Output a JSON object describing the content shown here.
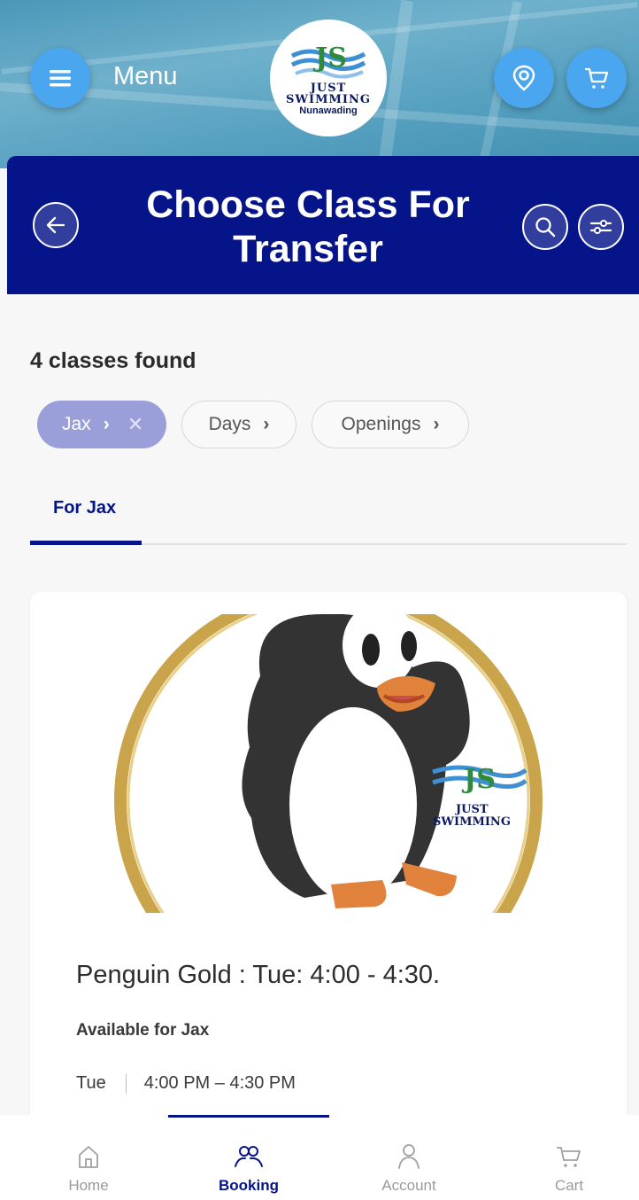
{
  "header": {
    "menu_label": "Menu",
    "logo": {
      "line1": "JUST",
      "line2": "SWIMMING",
      "line3": "Nunawading"
    },
    "icons": [
      "menu-icon",
      "location-pin-icon",
      "cart-icon"
    ]
  },
  "title_bar": {
    "title_line1": "Choose Class For",
    "title_line2": "Transfer",
    "icons": [
      "back-arrow-icon",
      "search-icon",
      "filter-sliders-icon"
    ]
  },
  "results": {
    "count_text": "4 classes found"
  },
  "filters": [
    {
      "label": "Jax",
      "active": true
    },
    {
      "label": "Days",
      "active": false
    },
    {
      "label": "Openings",
      "active": false
    }
  ],
  "tabs": [
    {
      "label": "For Jax",
      "selected": true
    }
  ],
  "class_card": {
    "image_text_line1": "JUST",
    "image_text_line2": "SWIMMING",
    "title": "Penguin Gold : Tue: 4:00 - 4:30.",
    "availability": "Available for Jax",
    "day": "Tue",
    "time": "4:00 PM – 4:30 PM"
  },
  "bottom_nav": [
    {
      "label": "Home",
      "icon": "home-icon",
      "active": false
    },
    {
      "label": "Booking",
      "icon": "people-icon",
      "active": true
    },
    {
      "label": "Account",
      "icon": "person-icon",
      "active": false
    },
    {
      "label": "Cart",
      "icon": "cart-icon",
      "active": false
    }
  ],
  "colors": {
    "primary": "#051488",
    "accent_button": "#4aa6ee",
    "chip_active": "#9b9fd9"
  }
}
